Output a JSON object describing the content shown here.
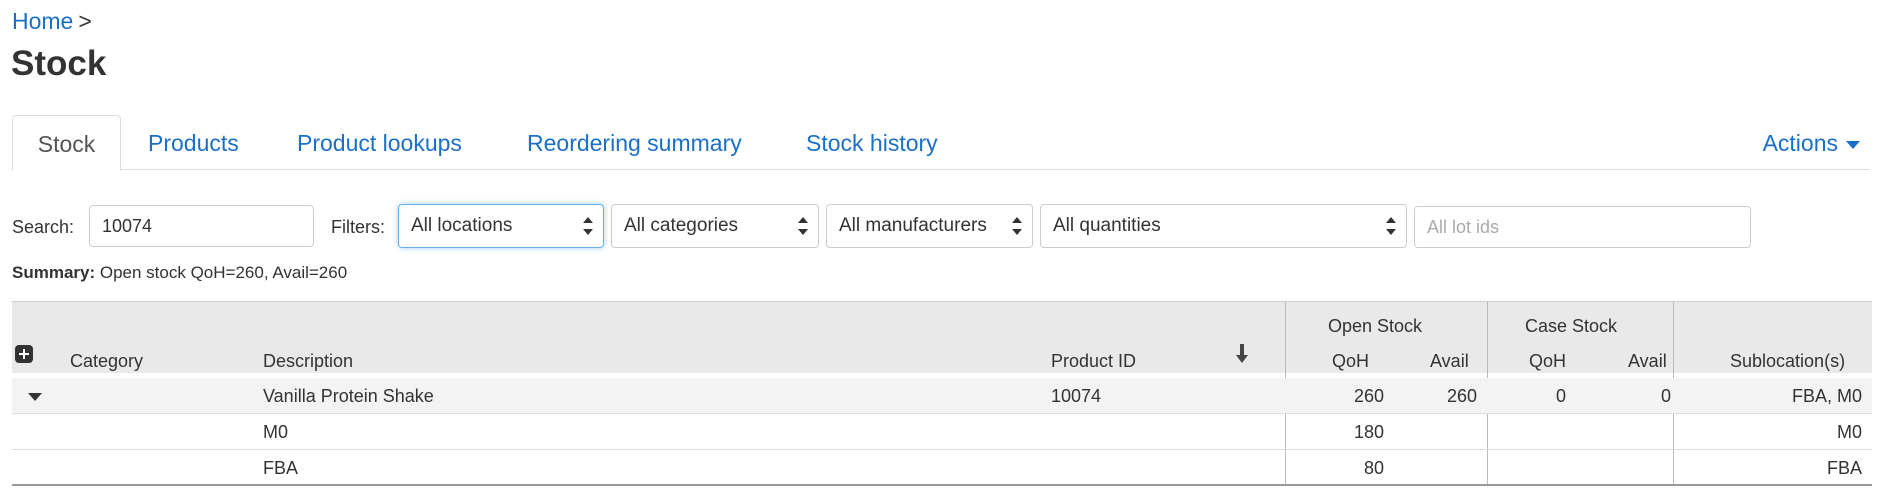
{
  "breadcrumb": {
    "home": "Home",
    "separator": ">"
  },
  "page_title": "Stock",
  "tabs": [
    {
      "label": "Stock",
      "active": true
    },
    {
      "label": "Products"
    },
    {
      "label": "Product lookups"
    },
    {
      "label": "Reordering summary"
    },
    {
      "label": "Stock history"
    }
  ],
  "actions_label": "Actions",
  "search": {
    "label": "Search:",
    "value": "10074"
  },
  "filters": {
    "label": "Filters:",
    "locations": "All locations",
    "categories": "All categories",
    "manufacturers": "All manufacturers",
    "quantities": "All quantities",
    "lot_ids_placeholder": "All lot ids"
  },
  "summary": {
    "label": "Summary:",
    "text": "Open stock QoH=260, Avail=260"
  },
  "table": {
    "group_headers": {
      "open_stock": "Open Stock",
      "case_stock": "Case Stock"
    },
    "columns": {
      "category": "Category",
      "description": "Description",
      "product_id": "Product ID",
      "open_qoh": "QoH",
      "open_avail": "Avail",
      "case_qoh": "QoH",
      "case_avail": "Avail",
      "sublocations": "Sublocation(s)"
    },
    "rows": [
      {
        "category": "",
        "description": "Vanilla Protein Shake",
        "product_id": "10074",
        "open_qoh": "260",
        "open_avail": "260",
        "case_qoh": "0",
        "case_avail": "0",
        "sublocations": "FBA, M0"
      },
      {
        "category": "",
        "description": "M0",
        "product_id": "",
        "open_qoh": "180",
        "open_avail": "",
        "case_qoh": "",
        "case_avail": "",
        "sublocations": "M0"
      },
      {
        "category": "",
        "description": "FBA",
        "product_id": "",
        "open_qoh": "80",
        "open_avail": "",
        "case_qoh": "",
        "case_avail": "",
        "sublocations": "FBA"
      }
    ]
  },
  "colors": {
    "link": "#1a6fc9",
    "header_bg": "#e9e9e9",
    "row_highlight": "#f3f3f3",
    "focus": "#66afe9"
  }
}
